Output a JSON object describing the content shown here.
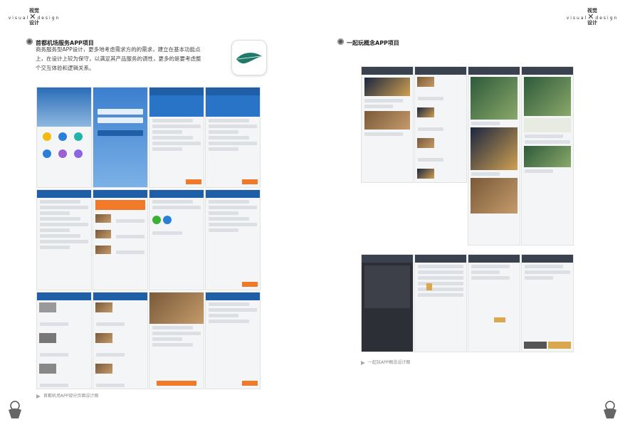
{
  "brand": {
    "title_cn_top": "视觉",
    "word_left": "visual",
    "word_right": "design",
    "title_cn_bottom": "设计"
  },
  "left_section": {
    "title": "首都机场服务APP项目",
    "description": "商务服务型APP设计，更多地考虑需求方的的需求，建立在基本功能点上，在设计上较为保守，以满足其产品服务的调性，更多的是要考虑整个交互体验和逻辑关系。",
    "caption": "首都机场APP部分页面设计图"
  },
  "right_section": {
    "title": "一起玩概念APP项目",
    "caption": "一起玩APP概念设计图"
  },
  "colors": {
    "airport_blue": "#1f5fa8",
    "accent_orange": "#f07a2a",
    "concept_dark": "#3a4250",
    "logo_green": "#1f7a6a"
  }
}
